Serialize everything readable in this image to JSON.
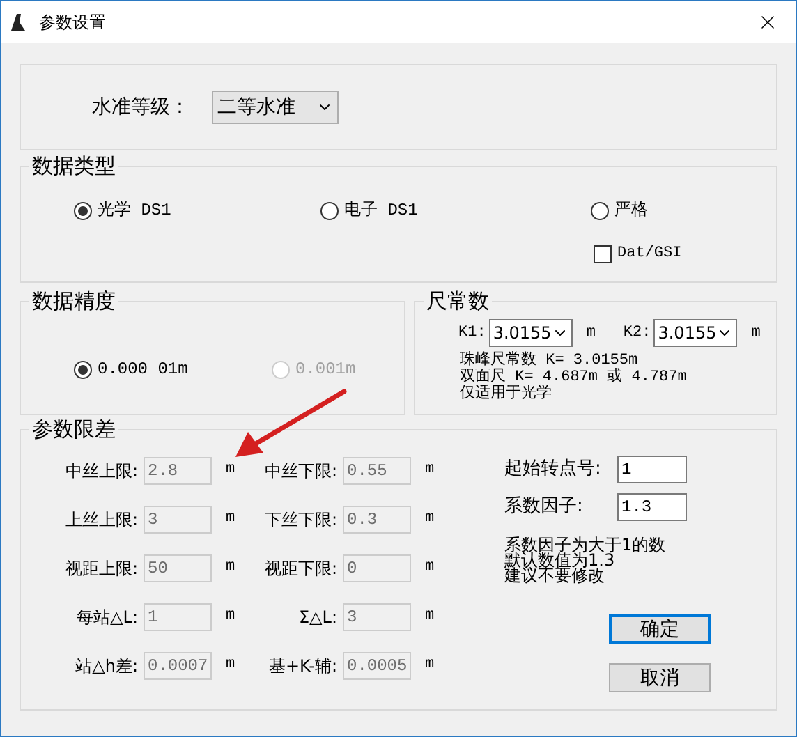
{
  "window": {
    "title": "参数设置"
  },
  "level_group": {
    "label": "水准等级：",
    "value": "二等水准"
  },
  "data_type": {
    "title": "数据类型",
    "options": [
      {
        "label": "光学 DS1",
        "selected": true
      },
      {
        "label": "电子 DS1",
        "selected": false
      },
      {
        "label": "严格",
        "selected": false
      }
    ],
    "dat_gsi": {
      "label": "Dat/GSI",
      "checked": false
    }
  },
  "precision": {
    "title": "数据精度",
    "options": [
      {
        "label": "0.000 01m",
        "selected": true,
        "disabled": false
      },
      {
        "label": "0.001m",
        "selected": false,
        "disabled": true
      }
    ]
  },
  "rod_constant": {
    "title": "尺常数",
    "fields": [
      {
        "label": "K1:",
        "value": "3.0155",
        "unit": "m"
      },
      {
        "label": "K2:",
        "value": "3.0155",
        "unit": "m"
      }
    ],
    "notes": [
      "珠峰尺常数 K= 3.0155m",
      "双面尺 K= 4.687m 或 4.787m",
      "仅适用于光学"
    ]
  },
  "limits": {
    "title": "参数限差",
    "rows": [
      {
        "left": {
          "label": "中丝上限:",
          "value": "2.8",
          "unit": "m",
          "disabled": true
        },
        "right": {
          "label": "中丝下限:",
          "value": "0.55",
          "unit": "m",
          "disabled": true
        }
      },
      {
        "left": {
          "label": "上丝上限:",
          "value": "3",
          "unit": "m",
          "disabled": true
        },
        "right": {
          "label": "下丝下限:",
          "value": "0.3",
          "unit": "m",
          "disabled": true
        }
      },
      {
        "left": {
          "label": "视距上限:",
          "value": "50",
          "unit": "m",
          "disabled": true
        },
        "right": {
          "label": "视距下限:",
          "value": "0",
          "unit": "m",
          "disabled": true
        }
      },
      {
        "left": {
          "label": "每站△L:",
          "value": "1",
          "unit": "m",
          "disabled": true
        },
        "right": {
          "label": "Σ△L:",
          "value": "3",
          "unit": "m",
          "disabled": true
        }
      },
      {
        "left": {
          "label": "站△h差:",
          "value": "0.0007",
          "unit": "m",
          "disabled": true
        },
        "right": {
          "label": "基+K-辅:",
          "value": "0.0005",
          "unit": "m",
          "disabled": true
        }
      }
    ],
    "settings": [
      {
        "label": "起始转点号:",
        "value": "1",
        "disabled": false
      },
      {
        "label": "系数因子:",
        "value": "1.3",
        "disabled": false
      }
    ],
    "notes": [
      "系数因子为大于1的数",
      "默认数值为1.3",
      "建议不要修改"
    ],
    "buttons": [
      {
        "label": "确定",
        "default": true
      },
      {
        "label": "取消",
        "default": false
      }
    ]
  }
}
